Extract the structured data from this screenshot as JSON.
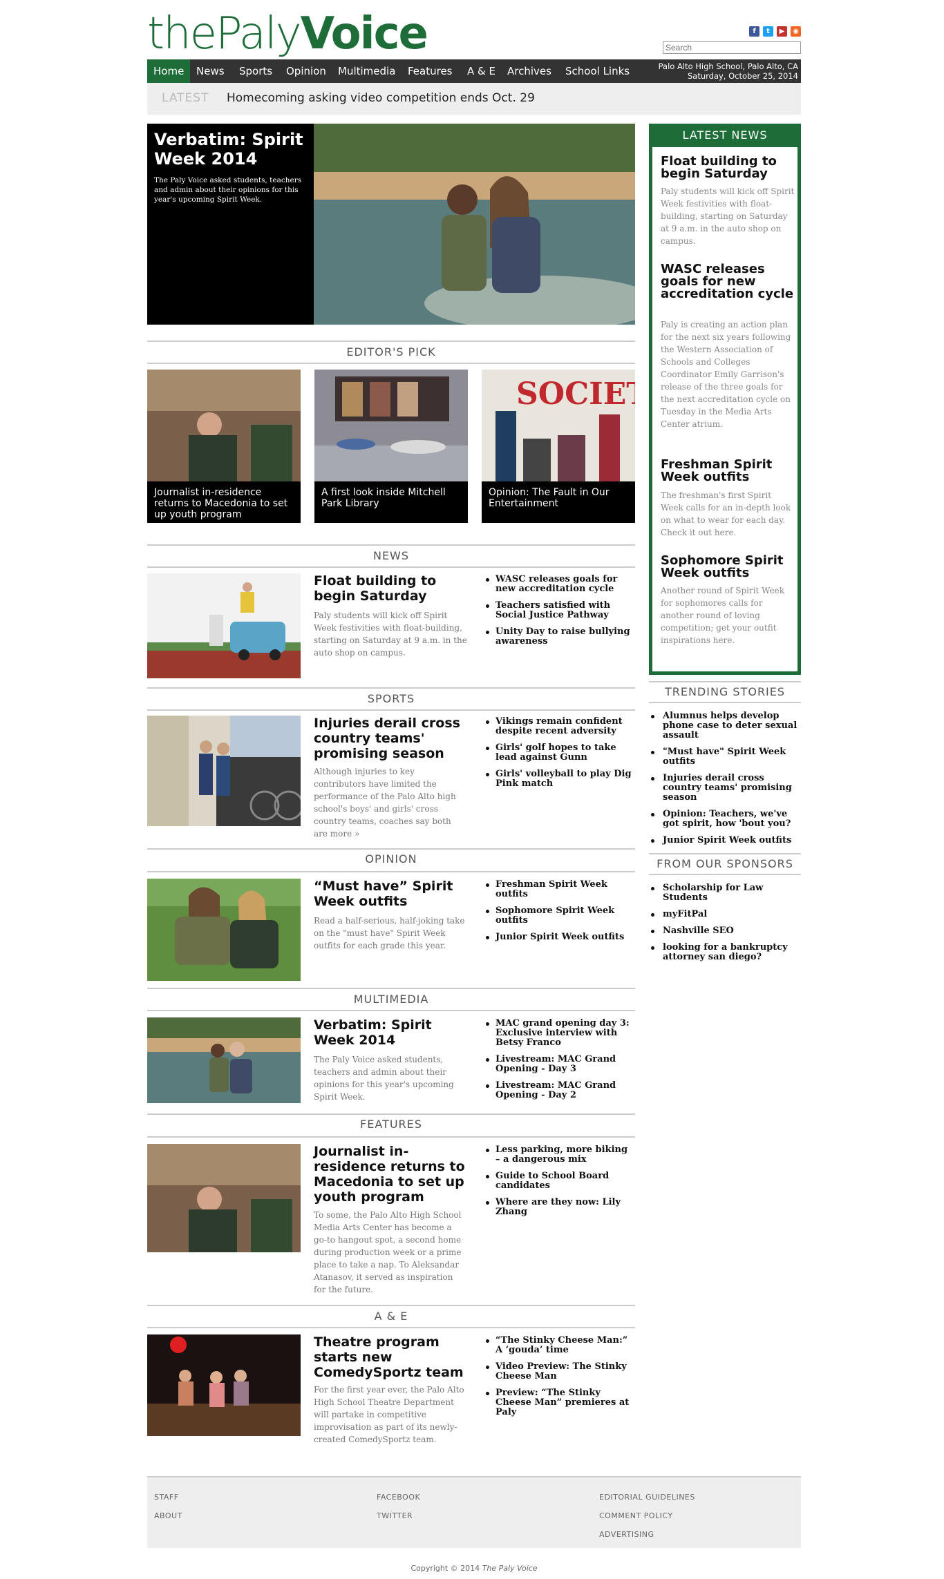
{
  "header": {
    "logo_part1": "thePaly",
    "logo_part2": "Voice",
    "search_placeholder": "Search",
    "social": [
      "facebook-icon",
      "twitter-icon",
      "youtube-icon",
      "rss-icon"
    ]
  },
  "nav": {
    "items": [
      "Home",
      "News",
      "Sports",
      "Opinion",
      "Multimedia",
      "Features",
      "A & E",
      "Archives",
      "School Links"
    ],
    "location": "Palo Alto High School, Palo Alto, CA",
    "date": "Saturday, October 25, 2014"
  },
  "ticker": {
    "label": "LATEST",
    "text": "Homecoming asking video competition ends Oct. 29"
  },
  "hero": {
    "title": "Verbatim: Spirit Week 2014",
    "excerpt": "The Paly Voice asked students, teachers and admin about their opinions for this year's upcoming Spirit Week."
  },
  "editors_pick": {
    "heading": "EDITOR'S PICK",
    "items": [
      "Journalist in-residence returns to Macedonia to set up youth program",
      "A first look inside Mitchell Park Library",
      "Opinion: The Fault in Our Entertainment"
    ]
  },
  "sections": {
    "news": {
      "heading": "NEWS",
      "title": "Float building to begin Saturday",
      "excerpt": "Paly students will kick off Spirit Week festivities with float-building, starting on Saturday at 9 a.m. in the auto shop on campus.",
      "links": [
        "WASC releases goals for new accreditation cycle",
        "Teachers satisfied with Social Justice Pathway",
        "Unity Day to raise bullying awareness"
      ]
    },
    "sports": {
      "heading": "SPORTS",
      "title": "Injuries derail cross country teams' promising season",
      "excerpt": "Although injuries to key contributors have limited the performance of the Palo Alto high school's boys' and girls' cross country teams, coaches say both are more »",
      "links": [
        "Vikings remain confident despite recent adversity",
        "Girls' golf hopes to take lead against Gunn",
        "Girls' volleyball to play Dig Pink match"
      ]
    },
    "opinion": {
      "heading": "OPINION",
      "title": "“Must have” Spirit Week outfits",
      "excerpt": "Read a half-serious, half-joking take on the \"must have\" Spirit Week outfits for each grade this year.",
      "links": [
        "Freshman Spirit Week outfits",
        "Sophomore Spirit Week outfits",
        "Junior Spirit Week outfits"
      ]
    },
    "multimedia": {
      "heading": "MULTIMEDIA",
      "title": "Verbatim: Spirit Week 2014",
      "excerpt": "The Paly Voice asked students, teachers and admin about their opinions for this year's upcoming Spirit Week.",
      "links": [
        "MAC grand opening day 3: Exclusive interview with Betsy Franco",
        "Livestream: MAC Grand Opening - Day 3",
        "Livestream: MAC Grand Opening - Day 2"
      ]
    },
    "features": {
      "heading": "FEATURES",
      "title": "Journalist in-residence returns to Macedonia to set up youth program",
      "excerpt": "To some, the Palo Alto High School Media Arts Center has become a go-to hangout spot, a second home during production week or a prime place to take a nap. To Aleksandar Atanasov, it served as inspiration for the future.",
      "links": [
        "Less parking, more biking – a dangerous mix",
        "Guide to School Board candidates",
        "Where are they now: Lily Zhang"
      ]
    },
    "ae": {
      "heading": "A & E",
      "title": "Theatre program starts new ComedySportz team",
      "excerpt": "For the first year ever, the Palo Alto High School Theatre Department will partake in competitive improvisation as part of its newly-created ComedySportz team.",
      "links": [
        "“The Stinky Cheese Man:” A ‘gouda’ time",
        "Video Preview: The Stinky Cheese Man",
        "Preview: “The Stinky Cheese Man” premieres at Paly"
      ]
    }
  },
  "sidebar": {
    "latest_heading": "LATEST NEWS",
    "stories": [
      {
        "title": "Float building to begin Saturday",
        "excerpt": "Paly students will kick off Spirit Week festivities with float-building, starting on Saturday at 9 a.m. in the auto shop on campus."
      },
      {
        "title": "WASC releases goals for new accreditation cycle",
        "excerpt": "Paly is creating an action plan for the next six years following the Western Association of Schools and Colleges Coordinator Emily Garrison's release of the three goals for the next accreditation cycle on Tuesday in the Media Arts Center atrium."
      },
      {
        "title": "Freshman Spirit Week outfits",
        "excerpt": "The freshman's first Spirit Week calls for an in-depth look on what to wear for each day. Check it out here."
      },
      {
        "title": "Sophomore Spirit Week outfits",
        "excerpt": "Another round of Spirit Week for sophomores calls for another round of loving competition; get your outfit inspirations here."
      }
    ],
    "trending_heading": "TRENDING STORIES",
    "trending": [
      "Alumnus helps develop phone case to deter sexual assault",
      "\"Must have\" Spirit Week outfits",
      "Injuries derail cross country teams' promising season",
      "Opinion: Teachers, we've got spirit, how 'bout you?",
      "Junior Spirit Week outfits"
    ],
    "sponsors_heading": "FROM OUR SPONSORS",
    "sponsors": [
      "Scholarship for Law Students",
      "myFitPal",
      "Nashville SEO",
      "looking for a bankruptcy attorney san diego?"
    ]
  },
  "footer": {
    "col1": [
      "STAFF",
      "ABOUT"
    ],
    "col2": [
      "FACEBOOK",
      "TWITTER"
    ],
    "col3": [
      "EDITORIAL GUIDELINES",
      "COMMENT POLICY",
      "ADVERTISING"
    ],
    "copyright": "Copyright © 2014",
    "copyright_name": "The Paly Voice"
  }
}
